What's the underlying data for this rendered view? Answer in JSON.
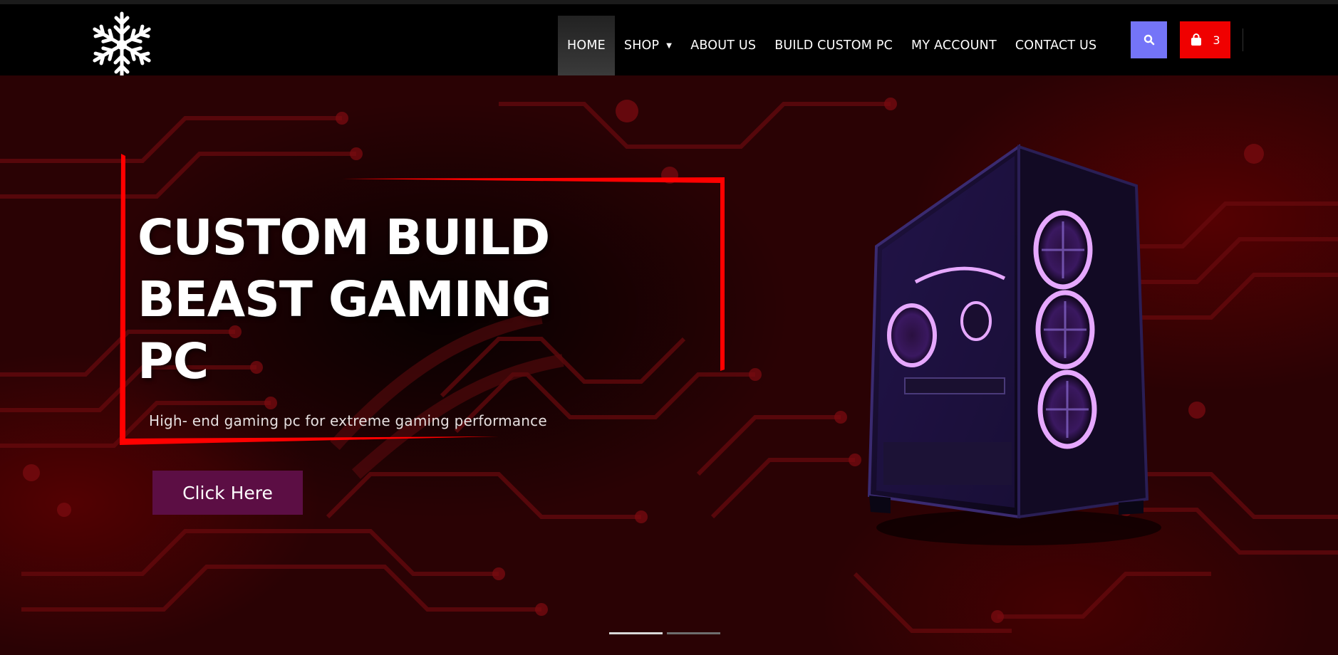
{
  "header": {
    "nav": [
      {
        "label": "HOME",
        "active": true,
        "has_dropdown": false
      },
      {
        "label": "SHOP",
        "active": false,
        "has_dropdown": true
      },
      {
        "label": "ABOUT US",
        "active": false,
        "has_dropdown": false
      },
      {
        "label": "BUILD CUSTOM PC",
        "active": false,
        "has_dropdown": false
      },
      {
        "label": "MY ACCOUNT",
        "active": false,
        "has_dropdown": false
      },
      {
        "label": "CONTACT US",
        "active": false,
        "has_dropdown": false
      }
    ],
    "cart_count": "3",
    "logo_icon": "snowflake-logo",
    "search_icon": "search-icon",
    "cart_icon": "shopping-bag-icon"
  },
  "hero": {
    "headline_lines": [
      "CUSTOM BUILD",
      "BEAST GAMING",
      "PC"
    ],
    "subtitle": "High- end gaming pc for extreme gaming performance",
    "cta_label": "Click Here",
    "slides": 2,
    "active_slide": 1
  },
  "colors": {
    "header_bg": "#000000",
    "search_button": "#7474f8",
    "cart_button": "#f00000",
    "cta_button": "#5c0e44",
    "accent_red": "#ff0000",
    "hero_bg": "#2a0204"
  }
}
